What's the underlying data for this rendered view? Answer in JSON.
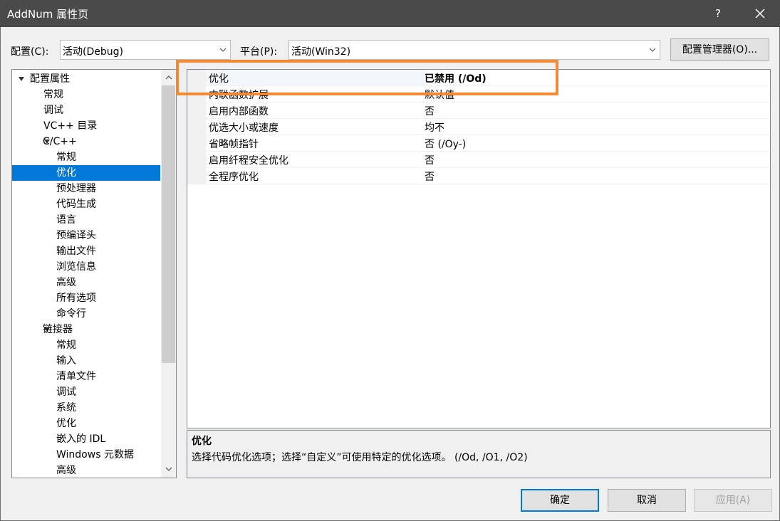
{
  "window": {
    "title": "AddNum 属性页",
    "help": "?",
    "close_icon": "close-icon"
  },
  "toolbar": {
    "config_label": "配置(C):",
    "config_value": "活动(Debug)",
    "platform_label": "平台(P):",
    "platform_value": "活动(Win32)",
    "config_manager_button": "配置管理器(O)..."
  },
  "tree": {
    "items": [
      {
        "label": "配置属性",
        "level": 0,
        "expanded": true
      },
      {
        "label": "常规",
        "level": 1
      },
      {
        "label": "调试",
        "level": 1
      },
      {
        "label": "VC++ 目录",
        "level": 1
      },
      {
        "label": "C/C++",
        "level": 1,
        "expanded": true
      },
      {
        "label": "常规",
        "level": 2
      },
      {
        "label": "优化",
        "level": 2,
        "selected": true
      },
      {
        "label": "预处理器",
        "level": 2
      },
      {
        "label": "代码生成",
        "level": 2
      },
      {
        "label": "语言",
        "level": 2
      },
      {
        "label": "预编译头",
        "level": 2
      },
      {
        "label": "输出文件",
        "level": 2
      },
      {
        "label": "浏览信息",
        "level": 2
      },
      {
        "label": "高级",
        "level": 2
      },
      {
        "label": "所有选项",
        "level": 2
      },
      {
        "label": "命令行",
        "level": 2
      },
      {
        "label": "链接器",
        "level": 1,
        "expanded": true
      },
      {
        "label": "常规",
        "level": 2
      },
      {
        "label": "输入",
        "level": 2
      },
      {
        "label": "清单文件",
        "level": 2
      },
      {
        "label": "调试",
        "level": 2
      },
      {
        "label": "系统",
        "level": 2
      },
      {
        "label": "优化",
        "level": 2
      },
      {
        "label": "嵌入的 IDL",
        "level": 2
      },
      {
        "label": "Windows 元数据",
        "level": 2
      },
      {
        "label": "高级",
        "level": 2
      }
    ]
  },
  "properties": [
    {
      "name": "优化",
      "value": "已禁用 (/Od)",
      "bold": true,
      "selected": true
    },
    {
      "name": "内联函数扩展",
      "value": "默认值"
    },
    {
      "name": "启用内部函数",
      "value": "否"
    },
    {
      "name": "优选大小或速度",
      "value": "均不"
    },
    {
      "name": "省略帧指针",
      "value": "否 (/Oy-)"
    },
    {
      "name": "启用纤程安全优化",
      "value": "否"
    },
    {
      "name": "全程序优化",
      "value": "否"
    }
  ],
  "description": {
    "title": "优化",
    "text": "选择代码优化选项；选择“自定义”可使用特定的优化选项。    (/Od, /O1, /O2)"
  },
  "buttons": {
    "ok": "确定",
    "cancel": "取消",
    "apply": "应用(A)"
  },
  "colors": {
    "accent": "#0078d7",
    "highlight_box": "#f28a35",
    "titlebar": "#4a4a4a"
  }
}
